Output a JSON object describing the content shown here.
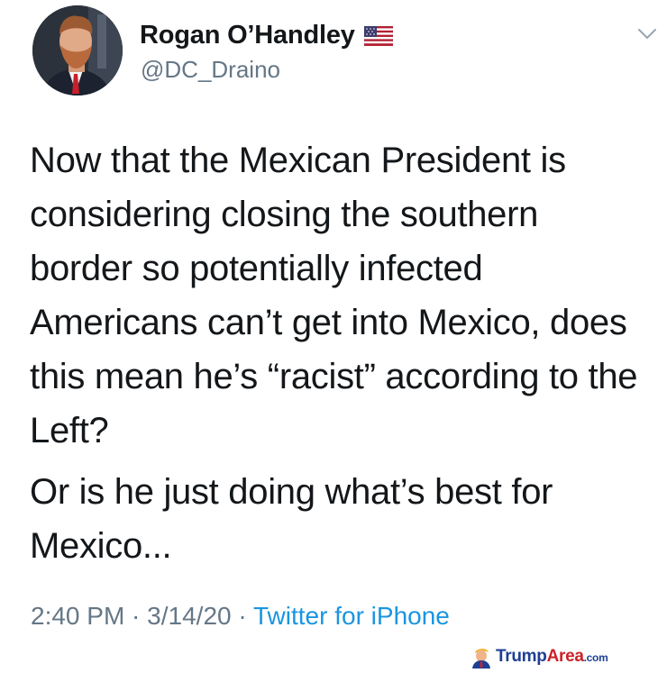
{
  "tweet": {
    "author": {
      "display_name": "Rogan O’Handley",
      "handle": "@DC_Draino",
      "badge_icon": "us-flag-icon",
      "avatar_icon": "profile-photo-avatar"
    },
    "menu_icon": "chevron-down-icon",
    "body": {
      "paragraph_1": "Now that the Mexican President is\nconsidering closing the southern\nborder so potentially infected\nAmericans can’t get into Mexico, does\nthis mean he’s “racist” according to the\nLeft?",
      "paragraph_2": "Or is he just doing what’s best for\nMexico..."
    },
    "meta": {
      "time": "2:40 PM",
      "separator": " · ",
      "date": "3/14/20",
      "source": "Twitter for iPhone"
    }
  },
  "watermark": {
    "part_1": "Trump",
    "part_2": "Area",
    "part_3": ".com",
    "logo_icon": "trump-head-logo-icon"
  },
  "colors": {
    "text": "#14171a",
    "secondary": "#657786",
    "link": "#1b95e0",
    "watermark_blue": "#1f3f93",
    "watermark_red": "#cc2229"
  }
}
